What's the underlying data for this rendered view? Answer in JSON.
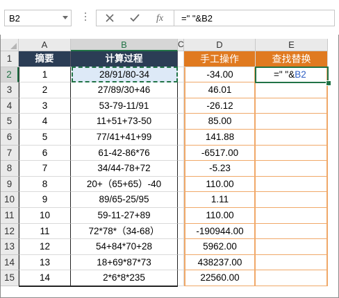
{
  "formula_bar": {
    "name_box": "B2",
    "cancel_icon": "cancel-x-icon",
    "enter_icon": "enter-check-icon",
    "function_label": "fx",
    "formula": "=\" \"&B2"
  },
  "columns": [
    {
      "label": "A"
    },
    {
      "label": "B"
    },
    {
      "label": "C"
    },
    {
      "label": "D"
    },
    {
      "label": "E"
    }
  ],
  "rows": [
    "1",
    "2",
    "3",
    "4",
    "5",
    "6",
    "7",
    "8",
    "9",
    "10",
    "11",
    "12",
    "13",
    "14",
    "15"
  ],
  "headers": {
    "a": "摘要",
    "b": "计算过程",
    "d": "手工操作",
    "e": "查找替换"
  },
  "data_rows": [
    {
      "a": "1",
      "b": "28/91/80-34",
      "d": "-34.00"
    },
    {
      "a": "2",
      "b": "27/89/30+46",
      "d": "46.01"
    },
    {
      "a": "3",
      "b": "53-79-11/91",
      "d": "-26.12"
    },
    {
      "a": "4",
      "b": "11+51+73-50",
      "d": "85.00"
    },
    {
      "a": "5",
      "b": "77/41+41+99",
      "d": "141.88"
    },
    {
      "a": "6",
      "b": "61-42-86*76",
      "d": "-6517.00"
    },
    {
      "a": "7",
      "b": "34/44-78+72",
      "d": "-5.23"
    },
    {
      "a": "8",
      "b": "20+（65+65）-40",
      "d": "110.00"
    },
    {
      "a": "9",
      "b": "89/65-25/95",
      "d": "1.11"
    },
    {
      "a": "10",
      "b": "59-11-27+89",
      "d": "110.00"
    },
    {
      "a": "11",
      "b": "72*78*（34-68）",
      "d": "-190944.00"
    },
    {
      "a": "12",
      "b": "54+84*70+28",
      "d": "5962.00"
    },
    {
      "a": "13",
      "b": "18+69*87*73",
      "d": "438237.00"
    },
    {
      "a": "14",
      "b": "2*6*8*235",
      "d": "22560.00"
    }
  ],
  "editing_cell": {
    "prefix": "=\" \"&",
    "ref": "B2"
  },
  "colors": {
    "header_dark": "#2b3d55",
    "header_orange": "#e07a20",
    "orange_border": "#f0a868",
    "selection_green": "#217346",
    "ref_blue": "#2f5fc4"
  }
}
